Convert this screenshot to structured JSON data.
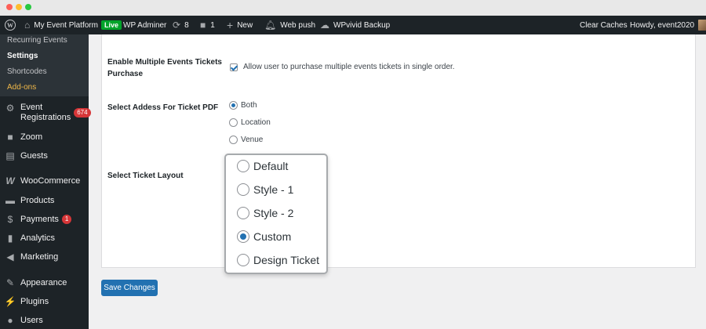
{
  "browser": {
    "dots": [
      "red",
      "yellow",
      "green"
    ]
  },
  "adminbar": {
    "site_name": "My Event Platform",
    "live_badge": "Live",
    "wp_adminer": "WP Adminer",
    "updates_count": "8",
    "comments_count": "1",
    "new_label": "New",
    "web_push": "Web push",
    "wpvivid": "WPvivid Backup",
    "clear_caches": "Clear Caches",
    "howdy": "Howdy, event2020"
  },
  "sidebar": {
    "submenu": [
      {
        "label": "Recurring Events"
      },
      {
        "label": "Settings"
      },
      {
        "label": "Shortcodes"
      },
      {
        "label": "Add-ons"
      }
    ],
    "event_registrations": {
      "line1": "Event",
      "line2": "Registrations",
      "badge": "674"
    },
    "items": [
      {
        "label": "Zoom",
        "icon": "video-icon"
      },
      {
        "label": "Guests",
        "icon": "id-card-icon"
      },
      {
        "label": "WooCommerce",
        "icon": "woo-icon"
      },
      {
        "label": "Products",
        "icon": "archive-icon"
      },
      {
        "label": "Payments",
        "icon": "dollar-icon",
        "badge": "1"
      },
      {
        "label": "Analytics",
        "icon": "bar-chart-icon"
      },
      {
        "label": "Marketing",
        "icon": "megaphone-icon"
      },
      {
        "label": "Appearance",
        "icon": "brush-icon"
      },
      {
        "label": "Plugins",
        "icon": "plug-icon"
      },
      {
        "label": "Users",
        "icon": "user-icon"
      }
    ]
  },
  "settings": {
    "multi_tickets": {
      "label_line1": "Enable Multiple Events Tickets",
      "label_line2": "Purchase",
      "checkbox_label": "Allow user to purchase multiple events tickets in single order.",
      "checked": true
    },
    "address": {
      "label": "Select Addess For Ticket PDF",
      "options": [
        "Both",
        "Location",
        "Venue"
      ],
      "selected": "Both"
    },
    "layout": {
      "label": "Select Ticket Layout",
      "options": [
        "Default",
        "Style - 1",
        "Style - 2",
        "Custom",
        "Design Ticket"
      ],
      "selected": "Custom"
    }
  },
  "save_button": "Save Changes",
  "colors": {
    "accent": "#2271b1",
    "sidebar_bg": "#1d2327",
    "addons": "#f0b849",
    "badge": "#d63638",
    "live": "#00a32a"
  }
}
